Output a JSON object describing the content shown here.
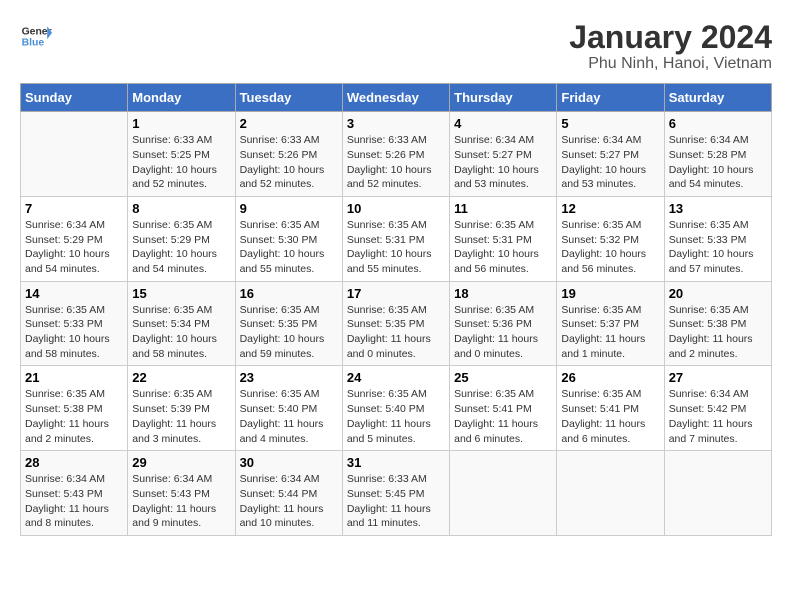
{
  "header": {
    "logo_line1": "General",
    "logo_line2": "Blue",
    "title": "January 2024",
    "subtitle": "Phu Ninh, Hanoi, Vietnam"
  },
  "days_of_week": [
    "Sunday",
    "Monday",
    "Tuesday",
    "Wednesday",
    "Thursday",
    "Friday",
    "Saturday"
  ],
  "weeks": [
    [
      {
        "day": "",
        "info": ""
      },
      {
        "day": "1",
        "info": "Sunrise: 6:33 AM\nSunset: 5:25 PM\nDaylight: 10 hours\nand 52 minutes."
      },
      {
        "day": "2",
        "info": "Sunrise: 6:33 AM\nSunset: 5:26 PM\nDaylight: 10 hours\nand 52 minutes."
      },
      {
        "day": "3",
        "info": "Sunrise: 6:33 AM\nSunset: 5:26 PM\nDaylight: 10 hours\nand 52 minutes."
      },
      {
        "day": "4",
        "info": "Sunrise: 6:34 AM\nSunset: 5:27 PM\nDaylight: 10 hours\nand 53 minutes."
      },
      {
        "day": "5",
        "info": "Sunrise: 6:34 AM\nSunset: 5:27 PM\nDaylight: 10 hours\nand 53 minutes."
      },
      {
        "day": "6",
        "info": "Sunrise: 6:34 AM\nSunset: 5:28 PM\nDaylight: 10 hours\nand 54 minutes."
      }
    ],
    [
      {
        "day": "7",
        "info": "Sunrise: 6:34 AM\nSunset: 5:29 PM\nDaylight: 10 hours\nand 54 minutes."
      },
      {
        "day": "8",
        "info": "Sunrise: 6:35 AM\nSunset: 5:29 PM\nDaylight: 10 hours\nand 54 minutes."
      },
      {
        "day": "9",
        "info": "Sunrise: 6:35 AM\nSunset: 5:30 PM\nDaylight: 10 hours\nand 55 minutes."
      },
      {
        "day": "10",
        "info": "Sunrise: 6:35 AM\nSunset: 5:31 PM\nDaylight: 10 hours\nand 55 minutes."
      },
      {
        "day": "11",
        "info": "Sunrise: 6:35 AM\nSunset: 5:31 PM\nDaylight: 10 hours\nand 56 minutes."
      },
      {
        "day": "12",
        "info": "Sunrise: 6:35 AM\nSunset: 5:32 PM\nDaylight: 10 hours\nand 56 minutes."
      },
      {
        "day": "13",
        "info": "Sunrise: 6:35 AM\nSunset: 5:33 PM\nDaylight: 10 hours\nand 57 minutes."
      }
    ],
    [
      {
        "day": "14",
        "info": "Sunrise: 6:35 AM\nSunset: 5:33 PM\nDaylight: 10 hours\nand 58 minutes."
      },
      {
        "day": "15",
        "info": "Sunrise: 6:35 AM\nSunset: 5:34 PM\nDaylight: 10 hours\nand 58 minutes."
      },
      {
        "day": "16",
        "info": "Sunrise: 6:35 AM\nSunset: 5:35 PM\nDaylight: 10 hours\nand 59 minutes."
      },
      {
        "day": "17",
        "info": "Sunrise: 6:35 AM\nSunset: 5:35 PM\nDaylight: 11 hours\nand 0 minutes."
      },
      {
        "day": "18",
        "info": "Sunrise: 6:35 AM\nSunset: 5:36 PM\nDaylight: 11 hours\nand 0 minutes."
      },
      {
        "day": "19",
        "info": "Sunrise: 6:35 AM\nSunset: 5:37 PM\nDaylight: 11 hours\nand 1 minute."
      },
      {
        "day": "20",
        "info": "Sunrise: 6:35 AM\nSunset: 5:38 PM\nDaylight: 11 hours\nand 2 minutes."
      }
    ],
    [
      {
        "day": "21",
        "info": "Sunrise: 6:35 AM\nSunset: 5:38 PM\nDaylight: 11 hours\nand 2 minutes."
      },
      {
        "day": "22",
        "info": "Sunrise: 6:35 AM\nSunset: 5:39 PM\nDaylight: 11 hours\nand 3 minutes."
      },
      {
        "day": "23",
        "info": "Sunrise: 6:35 AM\nSunset: 5:40 PM\nDaylight: 11 hours\nand 4 minutes."
      },
      {
        "day": "24",
        "info": "Sunrise: 6:35 AM\nSunset: 5:40 PM\nDaylight: 11 hours\nand 5 minutes."
      },
      {
        "day": "25",
        "info": "Sunrise: 6:35 AM\nSunset: 5:41 PM\nDaylight: 11 hours\nand 6 minutes."
      },
      {
        "day": "26",
        "info": "Sunrise: 6:35 AM\nSunset: 5:41 PM\nDaylight: 11 hours\nand 6 minutes."
      },
      {
        "day": "27",
        "info": "Sunrise: 6:34 AM\nSunset: 5:42 PM\nDaylight: 11 hours\nand 7 minutes."
      }
    ],
    [
      {
        "day": "28",
        "info": "Sunrise: 6:34 AM\nSunset: 5:43 PM\nDaylight: 11 hours\nand 8 minutes."
      },
      {
        "day": "29",
        "info": "Sunrise: 6:34 AM\nSunset: 5:43 PM\nDaylight: 11 hours\nand 9 minutes."
      },
      {
        "day": "30",
        "info": "Sunrise: 6:34 AM\nSunset: 5:44 PM\nDaylight: 11 hours\nand 10 minutes."
      },
      {
        "day": "31",
        "info": "Sunrise: 6:33 AM\nSunset: 5:45 PM\nDaylight: 11 hours\nand 11 minutes."
      },
      {
        "day": "",
        "info": ""
      },
      {
        "day": "",
        "info": ""
      },
      {
        "day": "",
        "info": ""
      }
    ]
  ]
}
